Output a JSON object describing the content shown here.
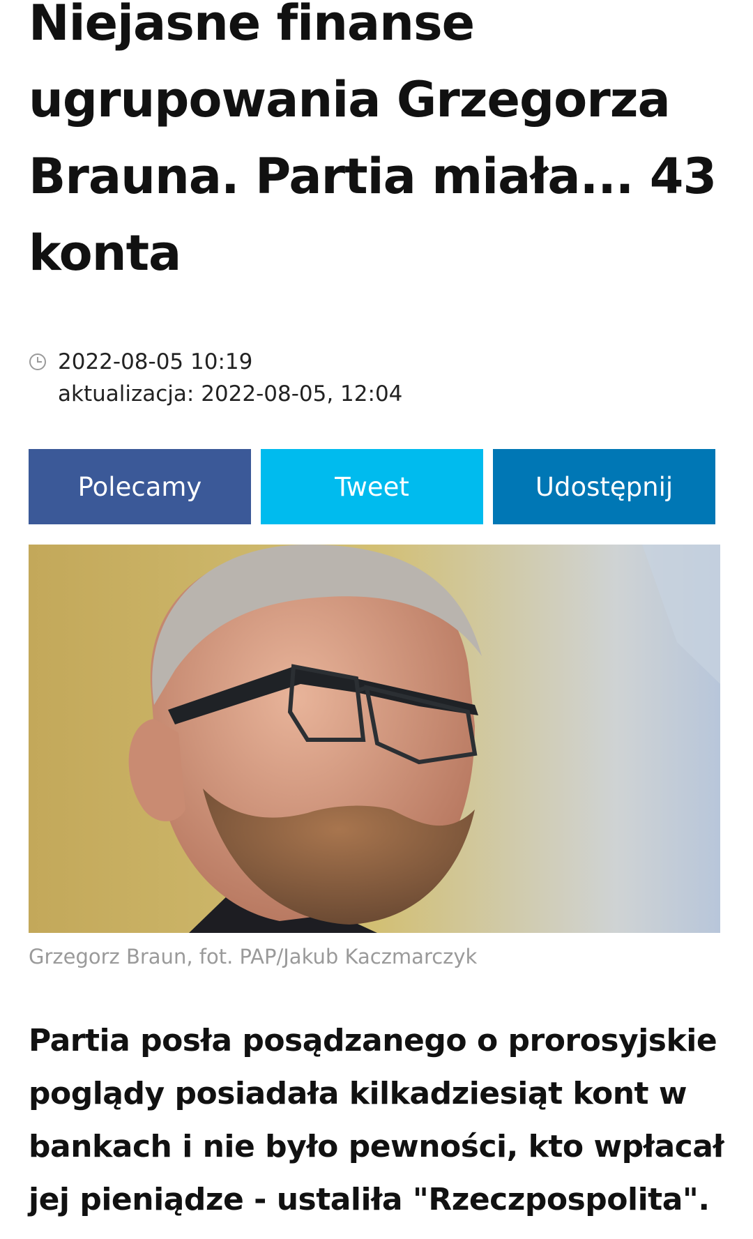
{
  "article": {
    "title": "Niejasne finanse ugrupowania Grzegorza Brauna. Partia miała... 43 konta",
    "published": "2022-08-05 10:19",
    "updated": "aktualizacja: 2022-08-05, 12:04",
    "image_caption": "Grzegorz Braun, fot. PAP/Jakub Kaczmarczyk",
    "lead": "Partia posła posądzanego o prorosyjskie poglądy posiadała kilkadziesiąt kont w bankach i nie było pewności, kto wpłacał jej pieniądze - ustaliła \"Rzeczpospolita\"."
  },
  "share": {
    "facebook_label": "Polecamy",
    "twitter_label": "Tweet",
    "linkedin_label": "Udostępnij"
  },
  "colors": {
    "facebook": "#3b5998",
    "twitter": "#00bbee",
    "linkedin": "#0077b5"
  },
  "icons": {
    "time": "clock-icon"
  }
}
